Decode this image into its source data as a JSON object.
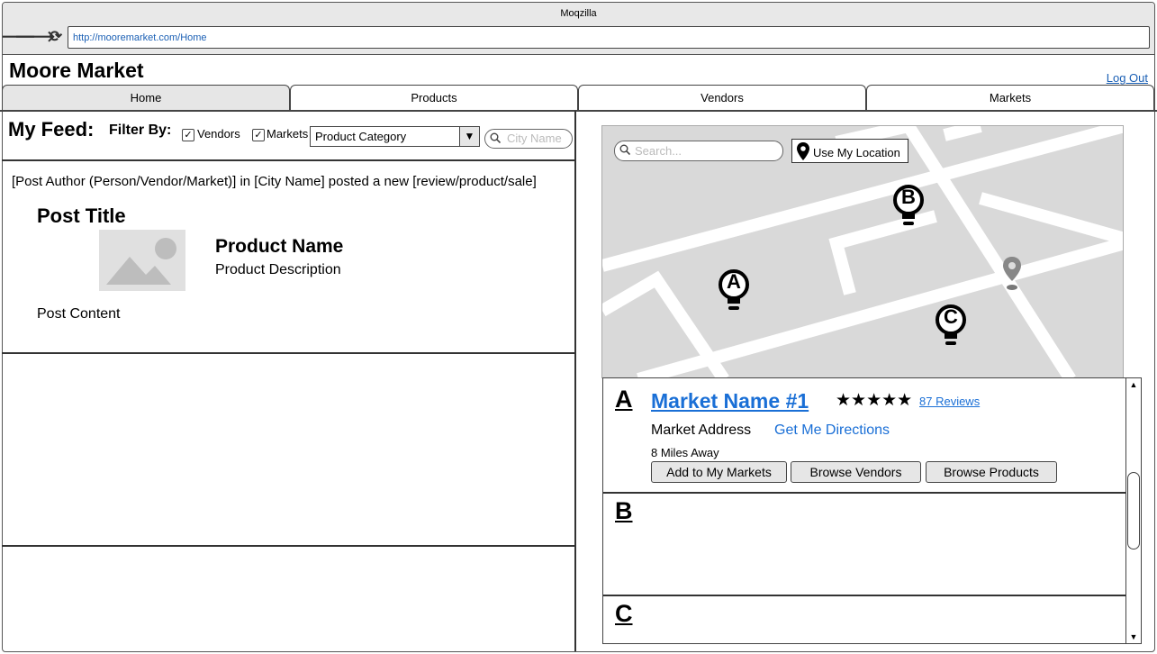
{
  "browser": {
    "title": "Moqzilla",
    "url": "http://mooremarket.com/Home",
    "back_glyph": "🡐",
    "forward_glyph": "🡒",
    "reload_glyph": "⟳"
  },
  "app": {
    "title": "Moore Market",
    "logout": "Log Out"
  },
  "tabs": [
    {
      "label": "Home",
      "active": true
    },
    {
      "label": "Products",
      "active": false
    },
    {
      "label": "Vendors",
      "active": false
    },
    {
      "label": "Markets",
      "active": false
    }
  ],
  "feed": {
    "title": "My Feed:",
    "filter_label": "Filter By:",
    "vendors_label": "Vendors",
    "vendors_checked": true,
    "markets_label": "Markets",
    "markets_checked": true,
    "check_glyph": "✓",
    "category_selected": "Product Category",
    "dropdown_glyph": "▼",
    "city_placeholder": "City Name",
    "post": {
      "meta": "[Post Author (Person/Vendor/Market)] in [City Name] posted a new [review/product/sale]",
      "title": "Post Title",
      "product_name": "Product Name",
      "product_description": "Product Description",
      "content": "Post Content"
    }
  },
  "map": {
    "search_placeholder": "Search...",
    "use_location_label": "Use My Location",
    "markers": [
      "A",
      "B",
      "C"
    ]
  },
  "results": [
    {
      "letter": "A",
      "name": "Market Name #1",
      "stars": "★★★★★",
      "rating": 5,
      "reviews": "87 Reviews",
      "address": "Market Address",
      "directions": "Get Me Directions",
      "distance": "8 Miles Away",
      "actions": [
        "Add to My Markets",
        "Browse Vendors",
        "Browse Products"
      ]
    },
    {
      "letter": "B"
    },
    {
      "letter": "C"
    }
  ],
  "scrollbar": {
    "up_glyph": "▲",
    "down_glyph": "▼"
  }
}
